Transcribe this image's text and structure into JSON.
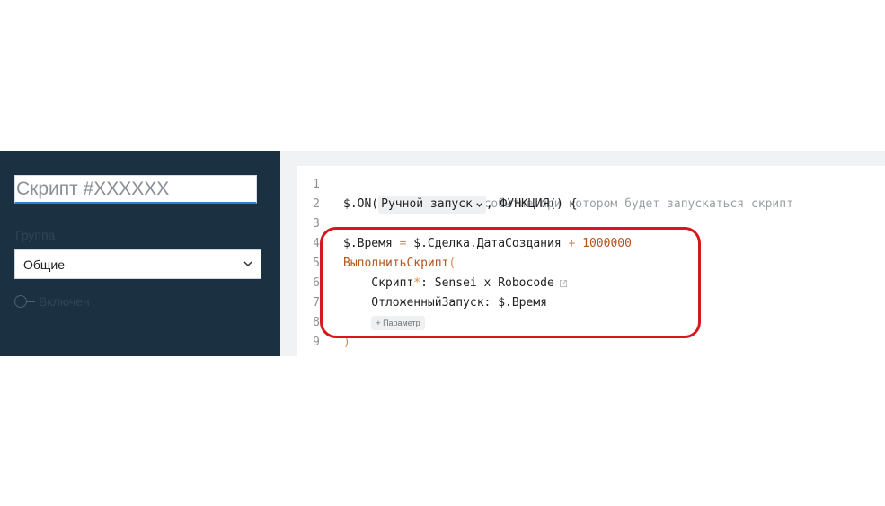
{
  "sidebar": {
    "title_placeholder": "Скрипт #XXXXXX",
    "group_label": "Группа",
    "group_value": "Общие",
    "toggle_label": "Включен"
  },
  "editor": {
    "line_numbers": [
      "1",
      "2",
      "3",
      "4",
      "5",
      "6",
      "7",
      "8",
      "9"
    ],
    "line1_comment": "// Определите событие при котором будет запускаться скрипт",
    "line2_prefix": "$.ON(",
    "line2_trigger": "Ручной запуск",
    "line2_suffix": ", ФУНКЦИЯ() {",
    "line4_var": "$.Время",
    "line4_eq": " = ",
    "line4_expr": "$.Сделка.ДатаСоздания",
    "line4_plus": " + ",
    "line4_num": "1000000",
    "line5_func": "ВыполнитьСкрипт",
    "line5_paren": "(",
    "line6_key": "    Скрипт",
    "line6_star": "*",
    "line6_sep": ": ",
    "line6_value": "Sensei x Robocode",
    "line7_key": "    ОтложенныйЗапуск",
    "line7_sep": ": ",
    "line7_value": "$.Время",
    "line8_indent": "    ",
    "line8_param": "+ Параметр",
    "line9": ")"
  },
  "colors": {
    "sidebar_bg": "#1b3040",
    "editor_bg": "#f1f2f4",
    "highlight": "#d7161e",
    "keyword": "#b3541e"
  }
}
